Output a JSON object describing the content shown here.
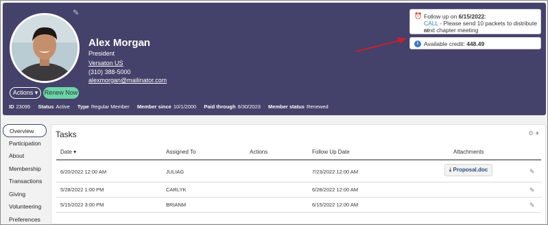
{
  "profile": {
    "name": "Alex Morgan",
    "title": "President",
    "organization": "Versaton US",
    "phone": "(310) 388-5000",
    "email": "alexmorgan@mailinator.com",
    "actions_label": "Actions ▾",
    "renew_label": "Renew Now"
  },
  "meta": {
    "id_label": "ID",
    "id_value": "23095",
    "status_label": "Status",
    "status_value": "Active",
    "type_label": "Type",
    "type_value": "Regular Member",
    "since_label": "Member since",
    "since_value": "10/1/2000",
    "paid_label": "Paid through",
    "paid_value": "6/30/2023",
    "mstatus_label": "Member status",
    "mstatus_value": "Renewed"
  },
  "followup": {
    "prefix": "Follow up on ",
    "date": "6/15/2022",
    "suffix": ":",
    "call": "CALL",
    "line2": " - Please send 10 packets to distribute at",
    "line3": "next chapter meeting"
  },
  "credit": {
    "label": "Available credit: ",
    "value": "448.49"
  },
  "nav": [
    "Overview",
    "Participation",
    "About",
    "Membership",
    "Transactions",
    "Giving",
    "Volunteering",
    "Preferences"
  ],
  "tasks": {
    "title": "Tasks",
    "headers": [
      "Date ▾",
      "Assigned To",
      "Actions",
      "Follow Up Date",
      "Attachments"
    ],
    "rows": [
      {
        "date": "6/20/2022 12:00 AM",
        "assigned": "JULIAG",
        "actions": "",
        "followup": "7/23/2022 12:00 AM",
        "attachment": "Proposal.doc"
      },
      {
        "date": "5/28/2022 1:00 PM",
        "assigned": "CARLYK",
        "actions": "",
        "followup": "6/28/2022 12:00 AM",
        "attachment": ""
      },
      {
        "date": "5/15/2022 3:00 PM",
        "assigned": "BRIANM",
        "actions": "",
        "followup": "6/15/2022 12:00 AM",
        "attachment": ""
      }
    ]
  },
  "colors": {
    "header_bg": "#44416a",
    "renew_green": "#6fd3a8",
    "link_blue": "#2f7fb8",
    "arrow_red": "#c0242f"
  },
  "icons": {
    "alarm": "alarm-clock-icon",
    "info": "info-icon",
    "edit": "pencil-icon",
    "download": "download-icon",
    "gear": "gear-icon",
    "plus": "plus-icon"
  }
}
